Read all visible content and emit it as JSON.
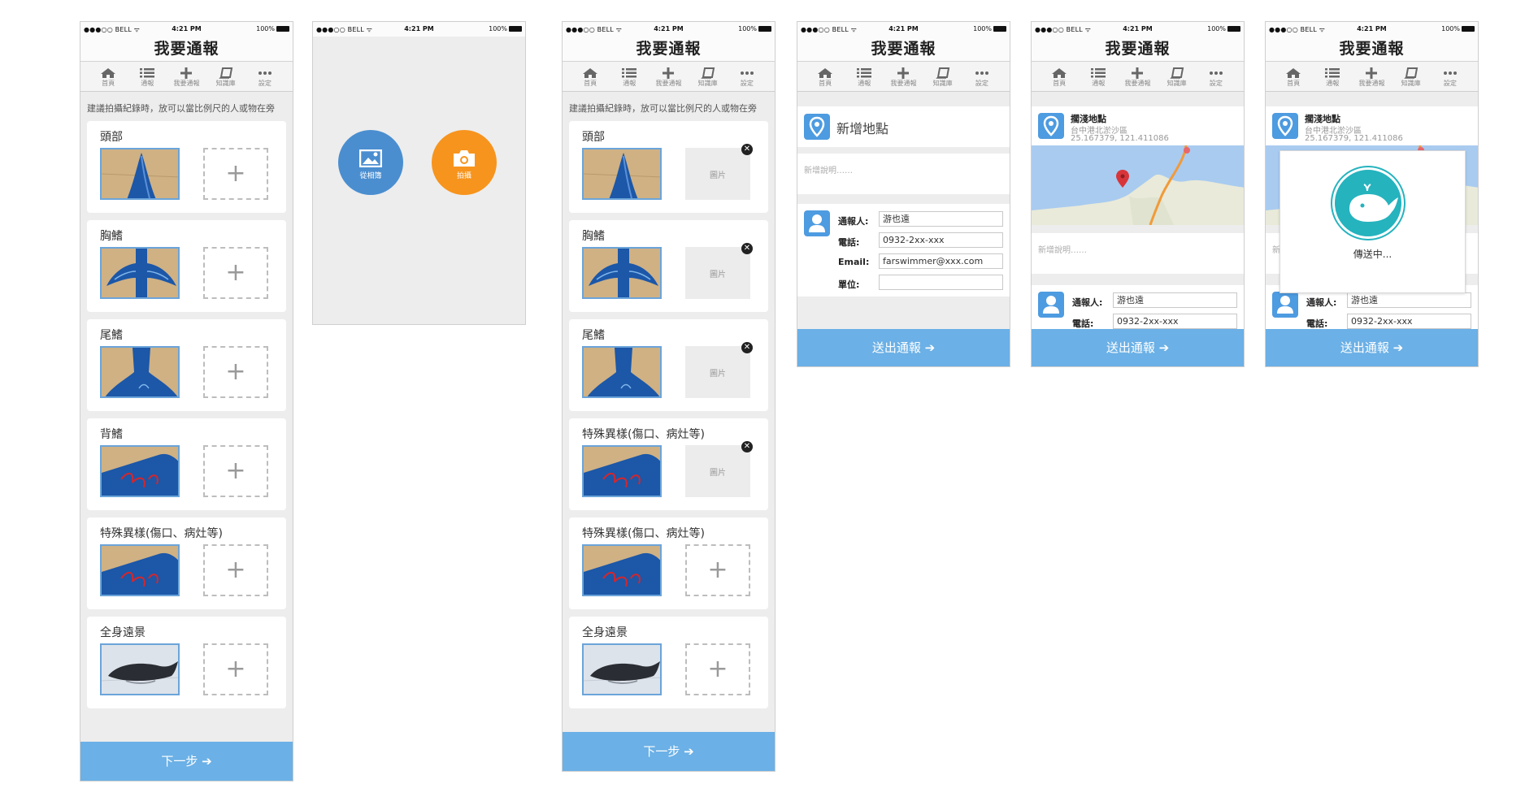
{
  "statusbar": {
    "carrier": "●●●○○ BELL ᯤ",
    "time": "4:21 PM",
    "battery": "100%"
  },
  "app": {
    "title": "我要通報",
    "tabs": [
      {
        "label": "首頁",
        "icon": "home-icon"
      },
      {
        "label": "通報",
        "icon": "list-icon"
      },
      {
        "label": "我要通報",
        "icon": "plus-icon"
      },
      {
        "label": "知識庫",
        "icon": "book-icon"
      },
      {
        "label": "設定",
        "icon": "more-icon"
      }
    ]
  },
  "photo": {
    "hint": "建議拍攝紀錄時，放可以當比例尺的人或物在旁",
    "sections": [
      "頭部",
      "胸鰭",
      "尾鰭",
      "背鰭",
      "特殊異樣(傷口、病灶等)",
      "全身遠景"
    ],
    "image_placeholder": "圖片",
    "remove_glyph": "✕",
    "add_glyph": "+",
    "next_button": "下一步 ➔"
  },
  "picker": {
    "album_label": "從相簿",
    "camera_label": "拍攝"
  },
  "report": {
    "new_location": "新增地點",
    "description_placeholder": "新增說明……",
    "location": {
      "name": "擱淺地點",
      "address": "台中港北淤沙區",
      "coords": "25.167379, 121.411086"
    },
    "fields": [
      {
        "label": "通報人:",
        "value": "游也遠"
      },
      {
        "label": "電話:",
        "value": "0932-2xx-xxx"
      },
      {
        "label": "Email:",
        "value": "farswimmer@xxx.com"
      },
      {
        "label": "單位:",
        "value": ""
      }
    ],
    "submit_button": "送出通報 ➔",
    "sending": "傳送中..."
  },
  "colors": {
    "accent": "#6bb0e6",
    "pin": "#4d9be0",
    "gallery": "#4a8ed0",
    "camera": "#f7941d",
    "whale": "#25b3be"
  }
}
